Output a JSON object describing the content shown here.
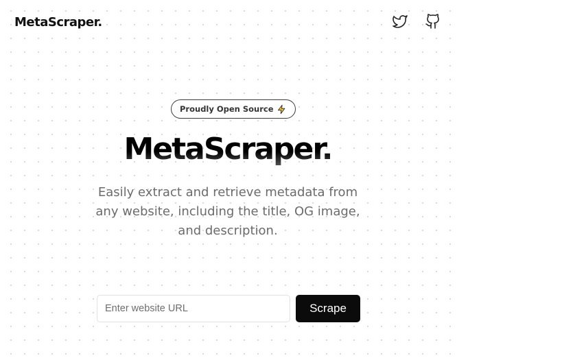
{
  "header": {
    "logo_text": "MetaScraper.",
    "icons": [
      {
        "name": "twitter-icon"
      },
      {
        "name": "github-icon"
      }
    ]
  },
  "hero": {
    "badge_text": "Proudly Open Source",
    "badge_icon": "lightning-icon",
    "title": "MetaScraper.",
    "description": "Easily extract and retrieve metadata from any website, including the title, OG image, and description."
  },
  "form": {
    "url_placeholder": "Enter website URL",
    "url_value": "",
    "submit_label": "Scrape"
  },
  "colors": {
    "primary_button": "#0b0b0b",
    "text_muted": "#6b6b6b",
    "badge_icon": "#f0b400"
  }
}
